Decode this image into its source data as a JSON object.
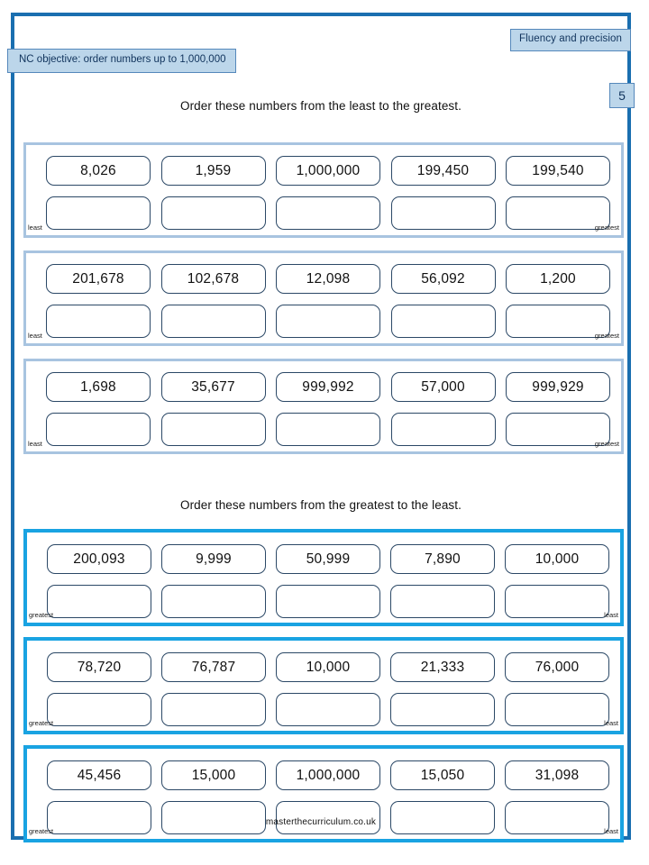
{
  "header": {
    "fluency_badge": "Fluency and precision",
    "nc_objective": "NC objective: order numbers up to 1,000,000",
    "page_number": "5"
  },
  "colors": {
    "page_border": "#1a6fb0",
    "badge_fill": "#bcd6ea",
    "badge_border": "#5588bb",
    "badge_text": "#10335c",
    "group_border_least": "#a8c4e0",
    "group_border_greatest": "#19a3e2",
    "cell_border": "#2b4866"
  },
  "sections": [
    {
      "instruction": "Order these numbers from the least to the greatest.",
      "left_label": "least",
      "right_label": "greatest",
      "groups": [
        {
          "numbers": [
            "8,026",
            "1,959",
            "1,000,000",
            "199,450",
            "199,540"
          ]
        },
        {
          "numbers": [
            "201,678",
            "102,678",
            "12,098",
            "56,092",
            "1,200"
          ]
        },
        {
          "numbers": [
            "1,698",
            "35,677",
            "999,992",
            "57,000",
            "999,929"
          ]
        }
      ]
    },
    {
      "instruction": "Order these numbers from the greatest to the least.",
      "left_label": "greatest",
      "right_label": "least",
      "groups": [
        {
          "numbers": [
            "200,093",
            "9,999",
            "50,999",
            "7,890",
            "10,000"
          ]
        },
        {
          "numbers": [
            "78,720",
            "76,787",
            "10,000",
            "21,333",
            "76,000"
          ]
        },
        {
          "numbers": [
            "45,456",
            "15,000",
            "1,000,000",
            "15,050",
            "31,098"
          ]
        }
      ]
    }
  ],
  "footer": "masterthecurriculum.co.uk"
}
